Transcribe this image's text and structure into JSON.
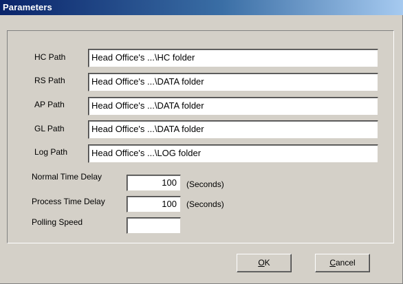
{
  "window": {
    "title": "Parameters"
  },
  "paths": [
    {
      "label": "HC Path",
      "value": "Head Office's ...\\HC folder"
    },
    {
      "label": "RS Path",
      "value": "Head Office's ...\\DATA folder"
    },
    {
      "label": "AP Path",
      "value": "Head Office's ...\\DATA folder"
    },
    {
      "label": "GL Path",
      "value": "Head Office's ...\\DATA folder"
    },
    {
      "label": "Log Path",
      "value": "Head Office's ...\\LOG folder"
    }
  ],
  "timing": {
    "normal_delay_label": "Normal Time Delay",
    "normal_delay_value": "100",
    "normal_delay_unit": "(Seconds)",
    "process_delay_label": "Process Time Delay",
    "process_delay_value": "100",
    "process_delay_unit": "(Seconds)",
    "polling_speed_label": "Polling Speed",
    "polling_speed_value": ""
  },
  "buttons": {
    "ok_mnemonic": "O",
    "ok_rest": "K",
    "cancel_mnemonic": "C",
    "cancel_rest": "ancel"
  },
  "colors": {
    "titlebar_start": "#0a246a",
    "titlebar_end": "#a6caf0",
    "dialog_face": "#d4d0c8"
  }
}
